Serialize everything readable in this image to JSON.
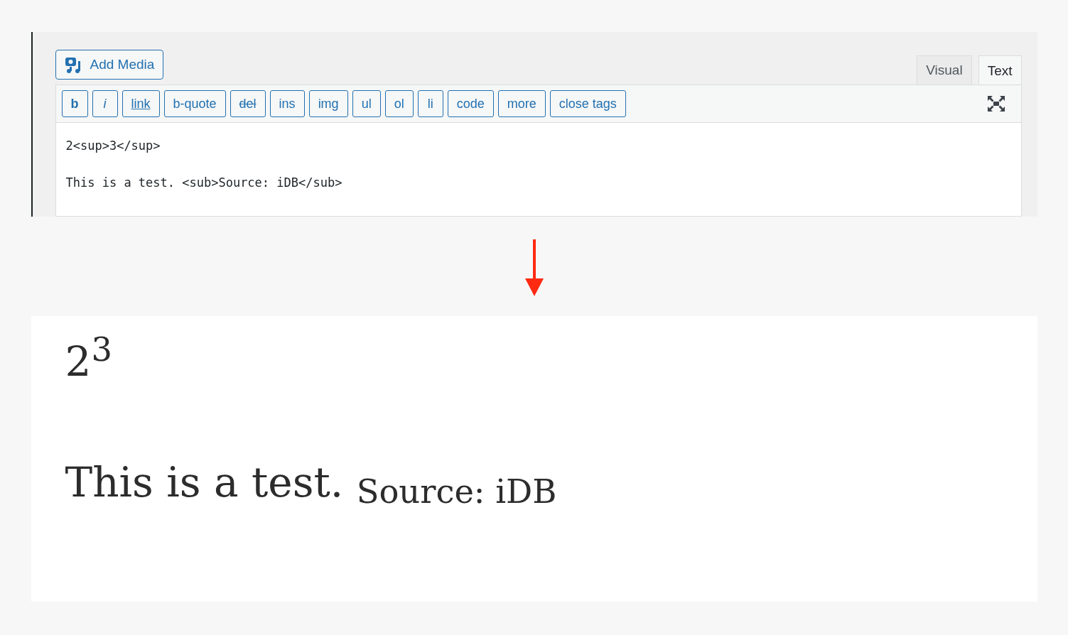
{
  "editor": {
    "add_media_button": "Add Media",
    "tabs": [
      {
        "label": "Visual",
        "selected": false
      },
      {
        "label": "Text",
        "selected": true
      }
    ],
    "toolbar_buttons": [
      {
        "label": "b",
        "kind": "bold"
      },
      {
        "label": "i",
        "kind": "italic"
      },
      {
        "label": "link",
        "kind": "underline"
      },
      {
        "label": "b-quote",
        "kind": "plain"
      },
      {
        "label": "del",
        "kind": "strike"
      },
      {
        "label": "ins",
        "kind": "plain"
      },
      {
        "label": "img",
        "kind": "plain"
      },
      {
        "label": "ul",
        "kind": "plain"
      },
      {
        "label": "ol",
        "kind": "plain"
      },
      {
        "label": "li",
        "kind": "plain"
      },
      {
        "label": "code",
        "kind": "plain"
      },
      {
        "label": "more",
        "kind": "plain"
      },
      {
        "label": "close tags",
        "kind": "plain"
      }
    ],
    "content_lines": [
      "2<sup>3</sup>",
      "This is a test. <sub>Source: iDB</sub>"
    ]
  },
  "preview": {
    "lines": [
      "2$^{3}$",
      "This is a test. $_{Source: iDB}$"
    ]
  }
}
